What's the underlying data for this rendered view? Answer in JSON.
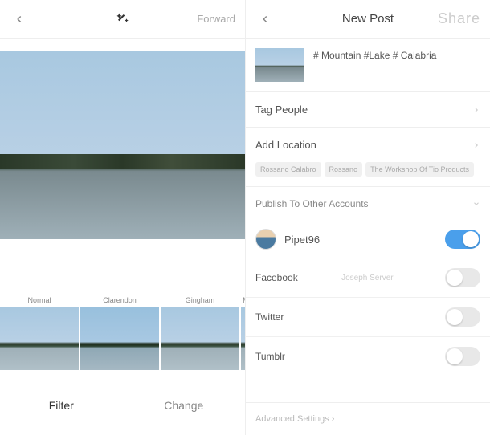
{
  "left": {
    "header": {
      "forward_label": "Forward"
    },
    "filters": [
      {
        "name": "Normal"
      },
      {
        "name": "Clarendon"
      },
      {
        "name": "Gingham"
      },
      {
        "name": "M"
      }
    ],
    "tabs": {
      "filter": "Filter",
      "change": "Change"
    }
  },
  "right": {
    "header": {
      "title": "New Post",
      "share": "Share"
    },
    "caption": "# Mountain #Lake # Calabria",
    "tag_people": "Tag People",
    "add_location": "Add Location",
    "location_suggestions": [
      "Rossano Calabro",
      "Rossano",
      "The Workshop Of Tio Products"
    ],
    "publish_section": "Publish To Other Accounts",
    "primary_account": {
      "username": "Pipet96",
      "enabled": true
    },
    "social": [
      {
        "name": "Facebook",
        "sub": "Joseph Server",
        "enabled": false
      },
      {
        "name": "Twitter",
        "sub": "",
        "enabled": false
      },
      {
        "name": "Tumblr",
        "sub": "",
        "enabled": false
      }
    ],
    "advanced": "Advanced Settings"
  }
}
